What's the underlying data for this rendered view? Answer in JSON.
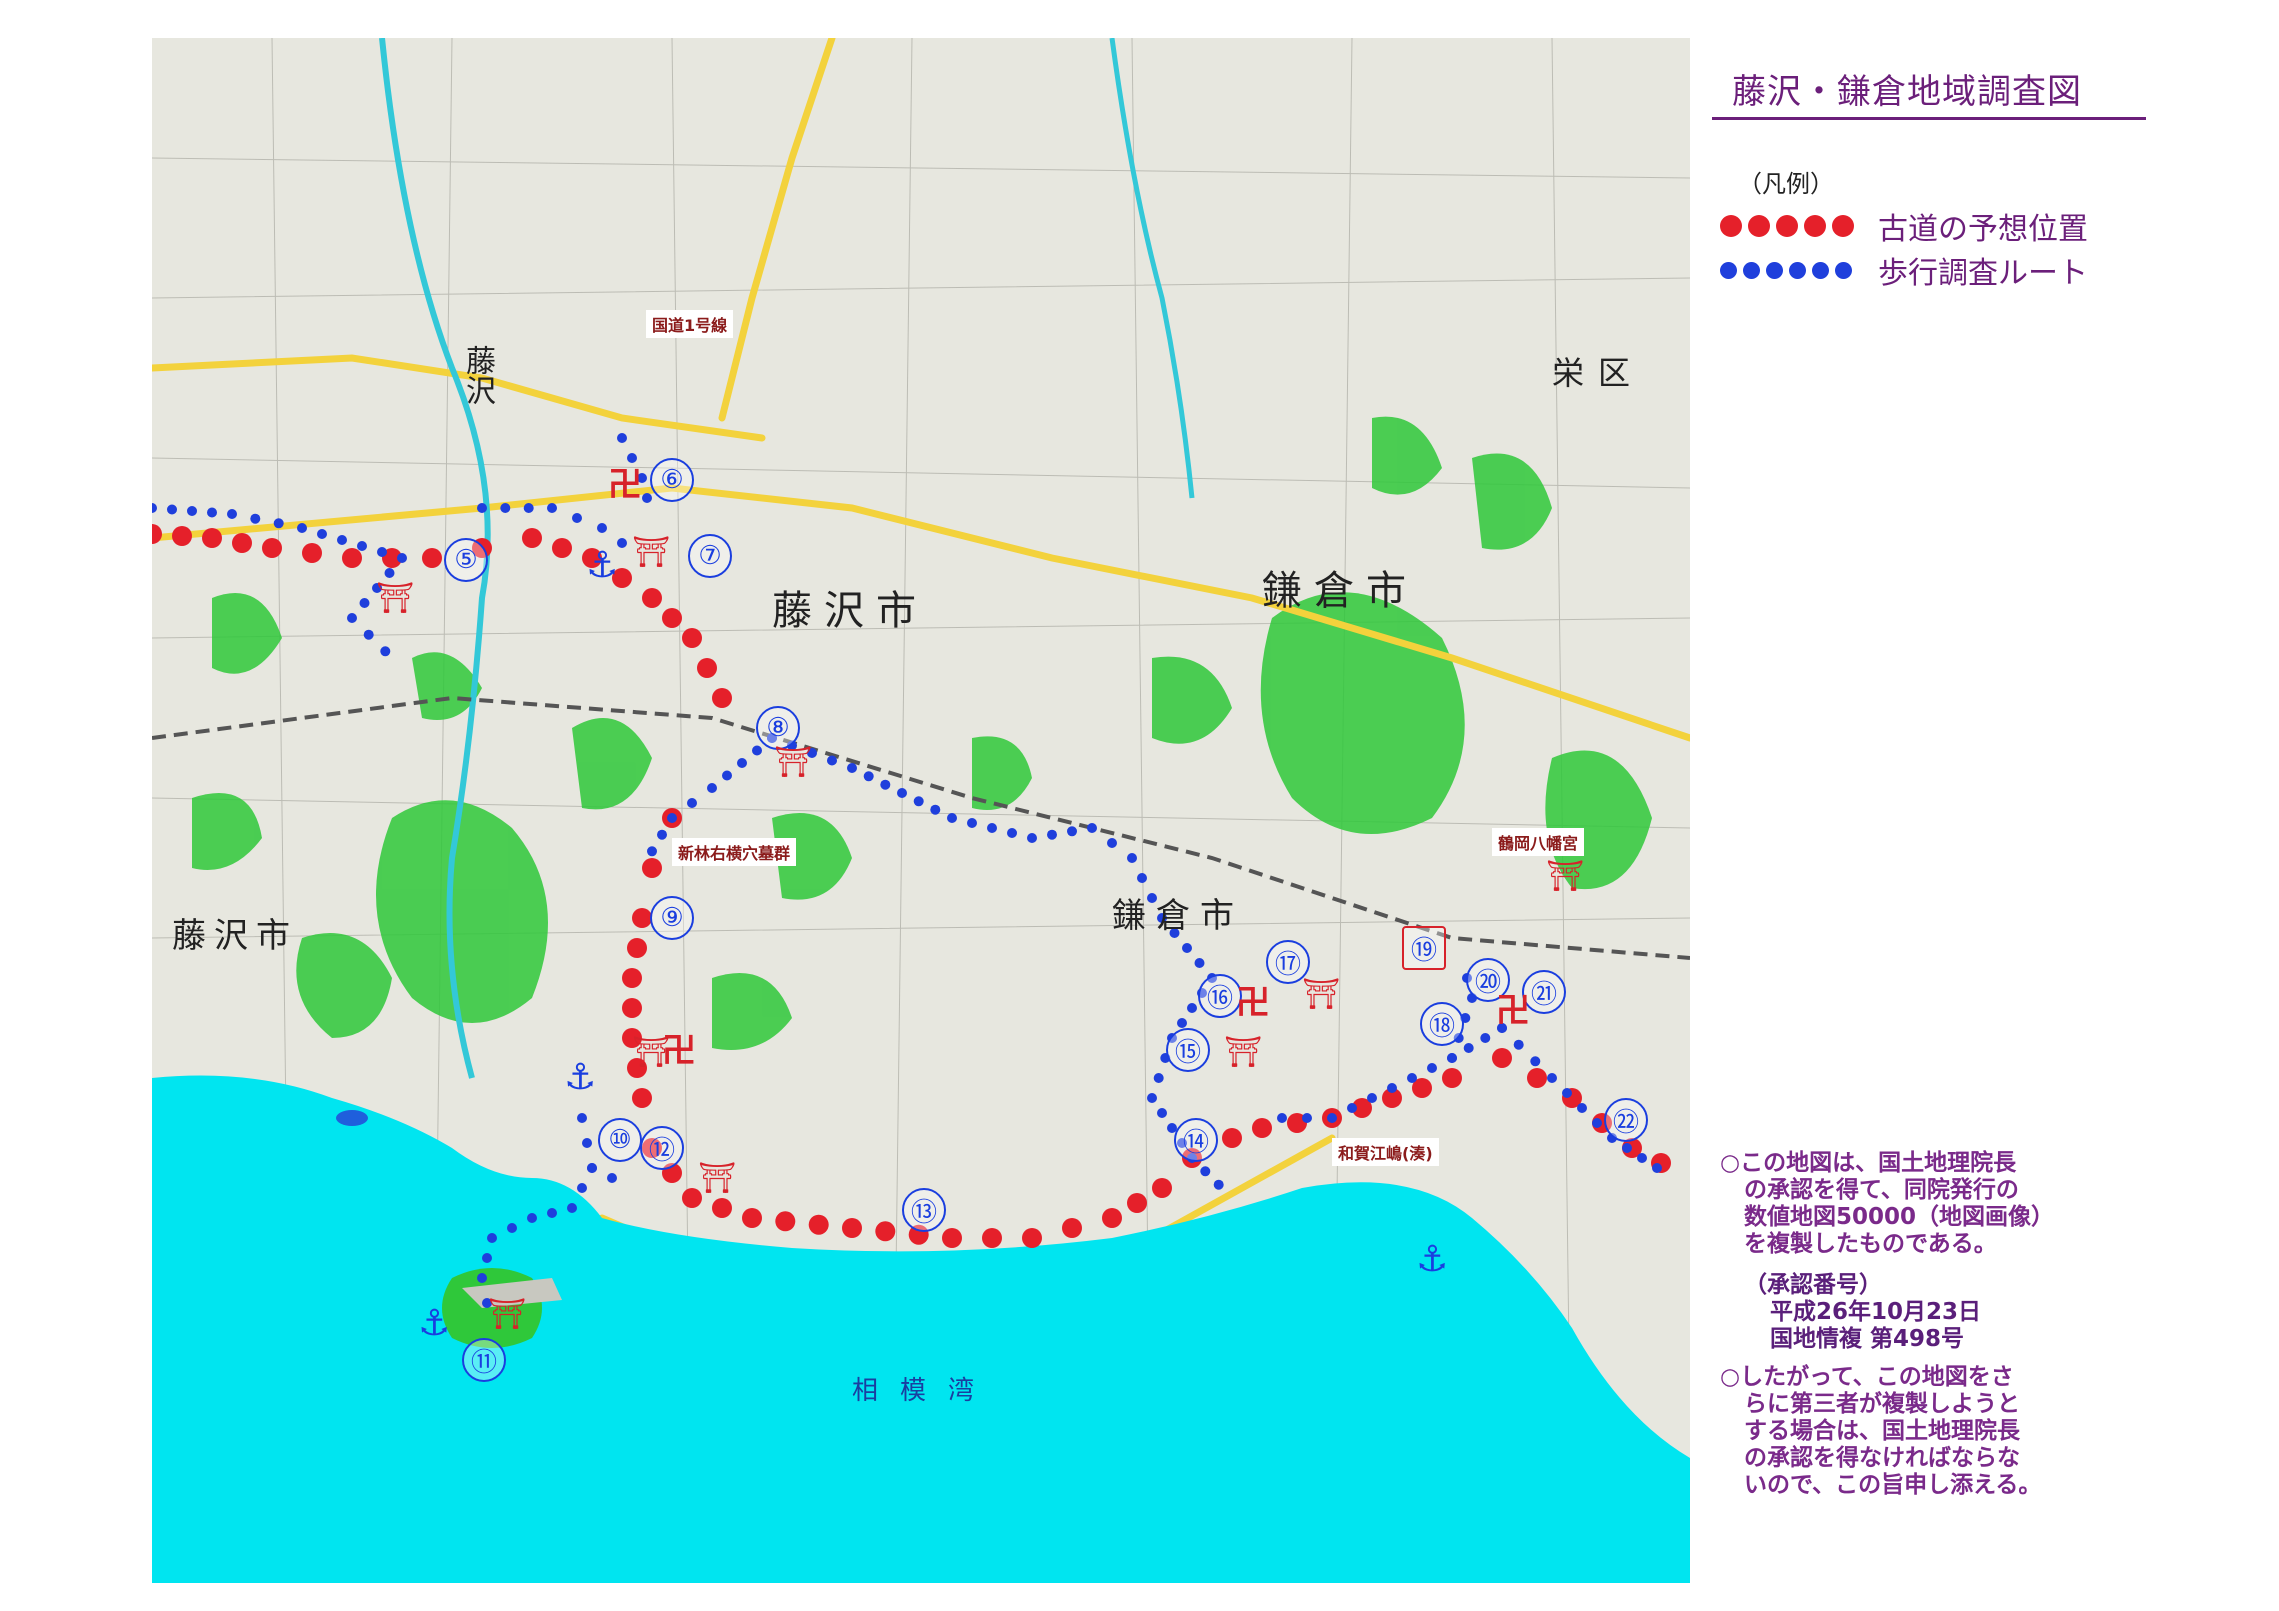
{
  "title": "藤沢・鎌倉地域調査図",
  "legend": {
    "heading": "（凡例）",
    "items": [
      {
        "label": "古道の予想位置",
        "color": "#e5202a",
        "dots": 5
      },
      {
        "label": "歩行調査ルート",
        "color": "#1f3fdc",
        "dots": 6
      }
    ]
  },
  "notes": {
    "note1": [
      "○この地図は、国土地理院長",
      "の承認を得て、同院発行の",
      "数値地図50000（地図画像）",
      "を複製したものである。"
    ],
    "approval": [
      "（承認番号）",
      "平成26年10月23日",
      "国地情複  第498号"
    ],
    "note2": [
      "○したがって、この地図をさ",
      "らに第三者が複製しようと",
      "する場合は、国土地理院長",
      "の承認を得なければならな",
      "いので、この旨申し添える。"
    ]
  },
  "map": {
    "labels": {
      "route1": "国道1号線",
      "tomb": "新林右横穴墓群",
      "hachimangu": "鶴岡八幡宮",
      "wagae": "和賀江嶋(湊)"
    },
    "places": {
      "fujisawa_city_n": "藤沢市",
      "kamakura_city_n": "鎌倉市",
      "fujisawa_city_s": "藤沢市",
      "kamakura_city_s": "鎌倉市",
      "fujisawa": "藤沢",
      "sakae_ku": "栄区",
      "sagami_bay": "相模湾"
    },
    "markers": [
      "⑤",
      "⑥",
      "⑦",
      "⑧",
      "⑨",
      "⑩",
      "⑪",
      "⑫",
      "⑬",
      "⑭",
      "⑮",
      "⑯",
      "⑰",
      "⑱",
      "⑲",
      "⑳",
      "㉑",
      "㉒"
    ],
    "symbols": {
      "temple": "卍",
      "shrine": "⛩",
      "anchor": "⚓"
    },
    "colors": {
      "sea": "#00e5f0",
      "green": "#2fc83a",
      "river": "#33c8d8",
      "road": "#f3d23c",
      "old_road": "#e5202a",
      "survey_route": "#1f3fdc"
    }
  }
}
